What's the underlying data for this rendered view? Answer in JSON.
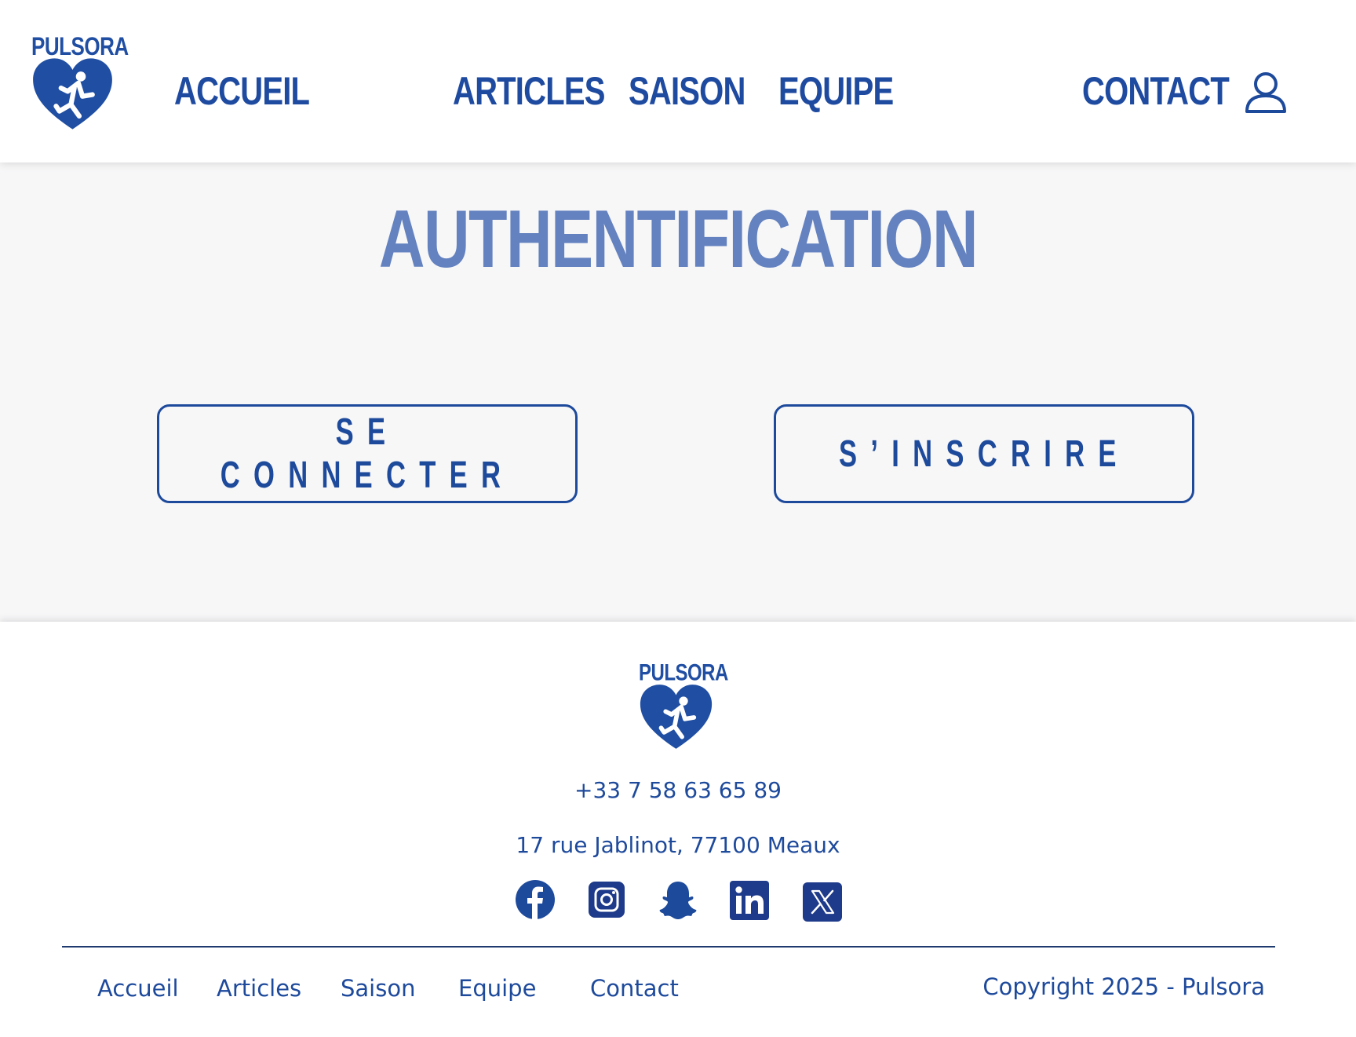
{
  "brand": {
    "name": "PULSORA",
    "color": "#1f4ea3"
  },
  "nav": {
    "accueil": "ACCUEIL",
    "articles": "ARTICLES",
    "saison": "SAISON",
    "equipe": "EQUIPE",
    "contact": "CONTACT",
    "user_icon": "user-icon"
  },
  "main": {
    "title": "AUTHENTIFICATION",
    "login_label": "SE CONNECTER",
    "signup_label": "S’INSCRIRE"
  },
  "footer": {
    "phone": "+33 7 58 63 65 89",
    "address": "17 rue Jablinot, 77100 Meaux",
    "social": [
      "facebook-icon",
      "instagram-icon",
      "snapchat-icon",
      "linkedin-icon",
      "x-icon"
    ],
    "links": {
      "accueil": "Accueil",
      "articles": "Articles",
      "saison": "Saison",
      "equipe": "Equipe",
      "contact": "Contact"
    },
    "copyright": "Copyright 2025 - Pulsora"
  },
  "colors": {
    "primary": "#1e4a9c",
    "title": "#6482bf",
    "background": "#f7f7f8"
  }
}
